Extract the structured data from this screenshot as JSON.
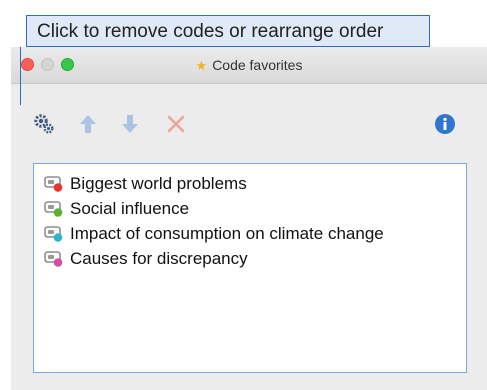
{
  "callout": {
    "text": "Click to remove codes or rearrange order"
  },
  "window": {
    "title": "Code favorites"
  },
  "toolbar": {
    "buttons": [
      {
        "icon": "code-settings-icon",
        "color": "#3d5a80"
      },
      {
        "icon": "arrow-up-icon",
        "color": "#a9c2e6"
      },
      {
        "icon": "arrow-down-icon",
        "color": "#a9c2e6"
      },
      {
        "icon": "remove-icon",
        "color": "#f0a39b"
      },
      {
        "icon": "info-icon",
        "color": "#2e76d0"
      }
    ]
  },
  "codes": [
    {
      "label": "Biggest world problems",
      "color": "#e8342b"
    },
    {
      "label": "Social influence",
      "color": "#5bb030"
    },
    {
      "label": "Impact of consumption on climate change",
      "color": "#2bb6cf"
    },
    {
      "label": "Causes for discrepancy",
      "color": "#d04fa3"
    }
  ]
}
